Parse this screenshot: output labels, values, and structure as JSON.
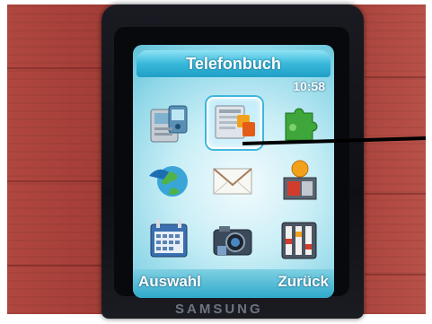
{
  "screen": {
    "title": "Telefonbuch",
    "time": "10:58"
  },
  "menu": {
    "items": [
      {
        "icon": "phonebook-device-icon"
      },
      {
        "icon": "contacts-card-icon",
        "selected": true
      },
      {
        "icon": "puzzle-piece-icon"
      },
      {
        "icon": "globe-network-icon"
      },
      {
        "icon": "envelope-message-icon"
      },
      {
        "icon": "media-box-icon"
      },
      {
        "icon": "calendar-organizer-icon"
      },
      {
        "icon": "camera-icon"
      },
      {
        "icon": "settings-panel-icon"
      }
    ]
  },
  "softkeys": {
    "left": "Auswahl",
    "right": "Zurück"
  },
  "device": {
    "brand": "SAMSUNG"
  },
  "colors": {
    "title_bar": "#2fb0d6",
    "screen_bg": "#c9eef6",
    "phone_body": "#111218",
    "table": "#a6423b",
    "selection_border": "#ffffff"
  }
}
